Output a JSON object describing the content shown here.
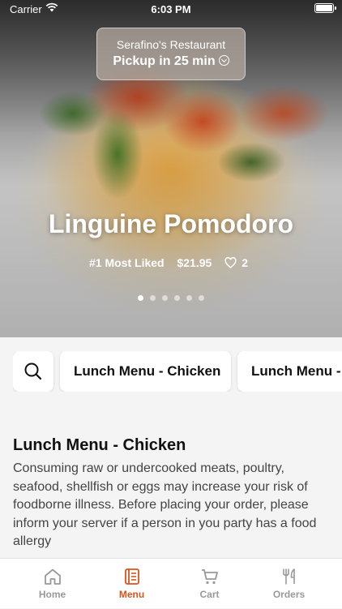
{
  "status_bar": {
    "carrier": "Carrier",
    "time": "6:03 PM"
  },
  "pickup": {
    "restaurant": "Serafino's Restaurant",
    "time_label": "Pickup in 25 min"
  },
  "featured": {
    "title": "Linguine Pomodoro",
    "badge": "#1 Most Liked",
    "price": "$21.95",
    "likes": "2",
    "slide_count": 6,
    "active_slide": 1
  },
  "categories": [
    "Lunch Menu - Chicken",
    "Lunch Menu -"
  ],
  "section": {
    "title": "Lunch Menu - Chicken",
    "disclaimer": "Consuming raw or undercooked meats, poultry, seafood, shellfish or eggs may increase your risk of foodborne illness. Before placing your order, please inform your server if a person in you party has a food allergy"
  },
  "tabs": [
    {
      "label": "Home",
      "icon": "home-icon"
    },
    {
      "label": "Menu",
      "icon": "menu-icon",
      "active": true
    },
    {
      "label": "Cart",
      "icon": "cart-icon"
    },
    {
      "label": "Orders",
      "icon": "fork-knife-icon"
    }
  ],
  "colors": {
    "accent": "#d9531e",
    "inactive": "#999999"
  }
}
